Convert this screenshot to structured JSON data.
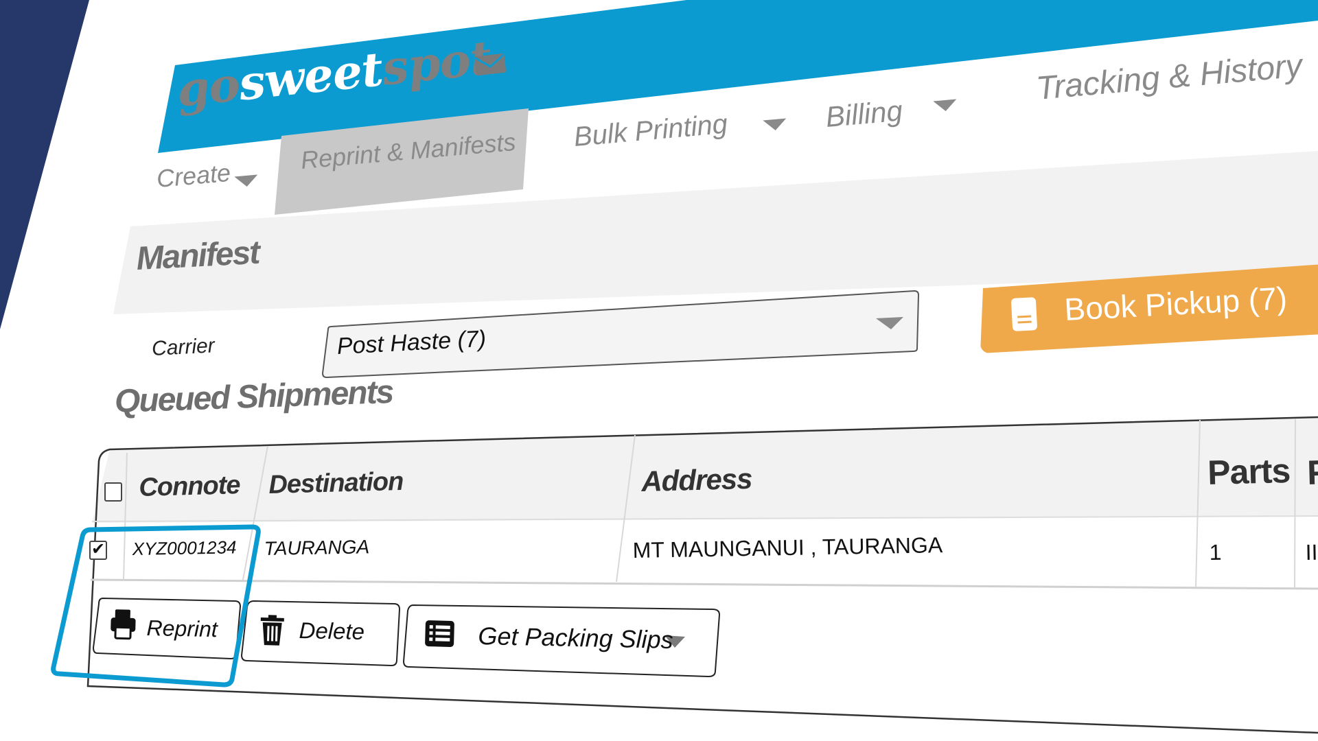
{
  "brand": {
    "logo_go": "go",
    "logo_sweet": "sweet",
    "logo_spot": "spot",
    "header_color": "#0b9bd1",
    "accent_orange": "#efa94a",
    "highlight_color": "#0b9bd1"
  },
  "nav": {
    "create": "Create",
    "reprint_manifests": "Reprint & Manifests",
    "bulk_printing": "Bulk Printing",
    "billing": "Billing",
    "tracking_history": "Tracking & History"
  },
  "manifest": {
    "title": "Manifest",
    "carrier_label": "Carrier",
    "carrier_value": "Post Haste (7)",
    "book_pickup_label": "Book Pickup (7)"
  },
  "queued": {
    "title": "Queued Shipments",
    "columns": {
      "connote": "Connote",
      "destination": "Destination",
      "address": "Address",
      "parts": "Parts",
      "partial": "F"
    },
    "rows": [
      {
        "checked": true,
        "connote": "XYZ0001234",
        "destination": "TAURANGA",
        "address": "MT MAUNGANUI , TAURANGA",
        "parts": "1",
        "partial": "II"
      }
    ],
    "actions": {
      "reprint": "Reprint",
      "delete": "Delete",
      "packing_slips": "Get Packing Slips"
    }
  },
  "icons": {
    "mail": "mail-icon",
    "book": "book-icon",
    "printer": "printer-icon",
    "trash": "trash-icon",
    "list": "list-icon"
  }
}
